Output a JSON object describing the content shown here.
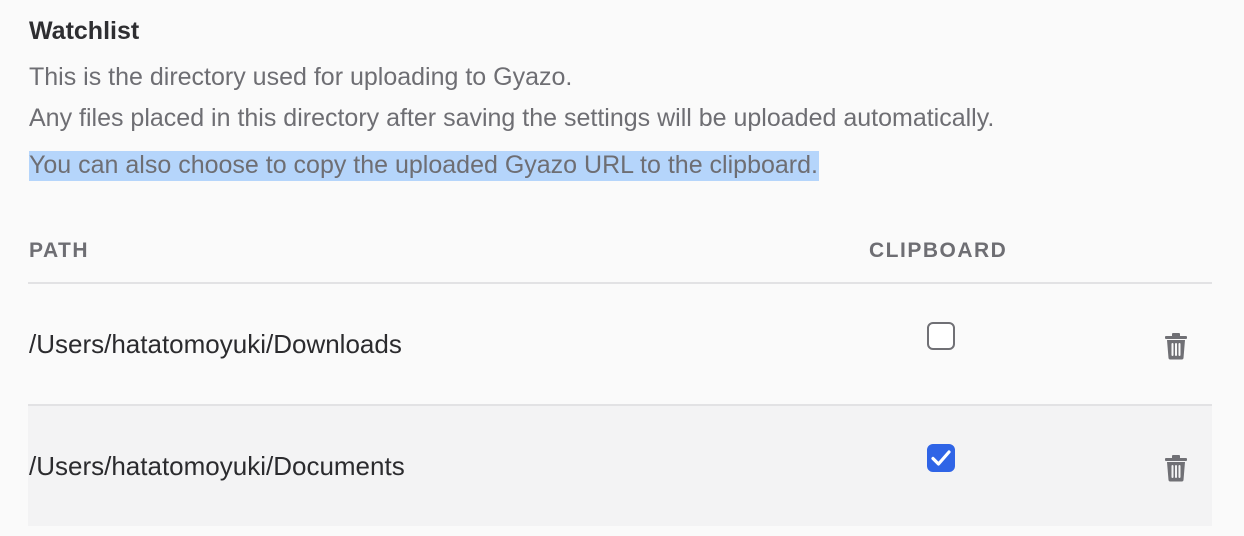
{
  "section": {
    "title": "Watchlist",
    "description_lines": [
      "This is the directory used for uploading to Gyazo.",
      "Any files placed in this directory after saving the settings will be uploaded automatically.",
      "You can also choose to copy the uploaded Gyazo URL to the clipboard."
    ]
  },
  "table": {
    "columns": {
      "path": "PATH",
      "clipboard": "CLIPBOARD"
    },
    "rows": [
      {
        "path": "/Users/hatatomoyuki/Downloads",
        "clipboard": false
      },
      {
        "path": "/Users/hatatomoyuki/Documents",
        "clipboard": true
      }
    ]
  },
  "icons": {
    "delete": "trash-icon",
    "check": "checkmark-icon"
  },
  "colors": {
    "accent": "#2f64e6",
    "selection": "#b5d5fb"
  }
}
